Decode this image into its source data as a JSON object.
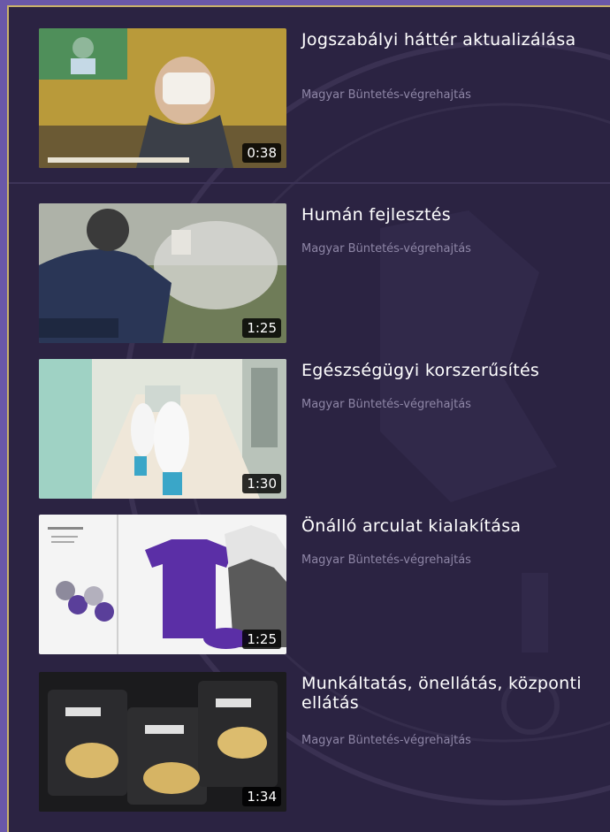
{
  "channel_name": "Magyar Büntetés-végrehajtás",
  "videos": [
    {
      "title": "Jogszabályi háttér aktualizálása",
      "duration": "0:38"
    },
    {
      "title": "Humán fejlesztés",
      "duration": "1:25"
    },
    {
      "title": "Egészségügyi korszerűsítés",
      "duration": "1:30"
    },
    {
      "title": "Önálló arculat kialakítása",
      "duration": "1:25"
    },
    {
      "title": "Munkáltatás, önellátás, központi ellátás",
      "duration": "1:34"
    }
  ],
  "colors": {
    "background": "#2b2342",
    "outer": "#6a58a8",
    "accent_border": "#c9b26a",
    "title_text": "#ffffff",
    "channel_text": "#8e86a6"
  }
}
